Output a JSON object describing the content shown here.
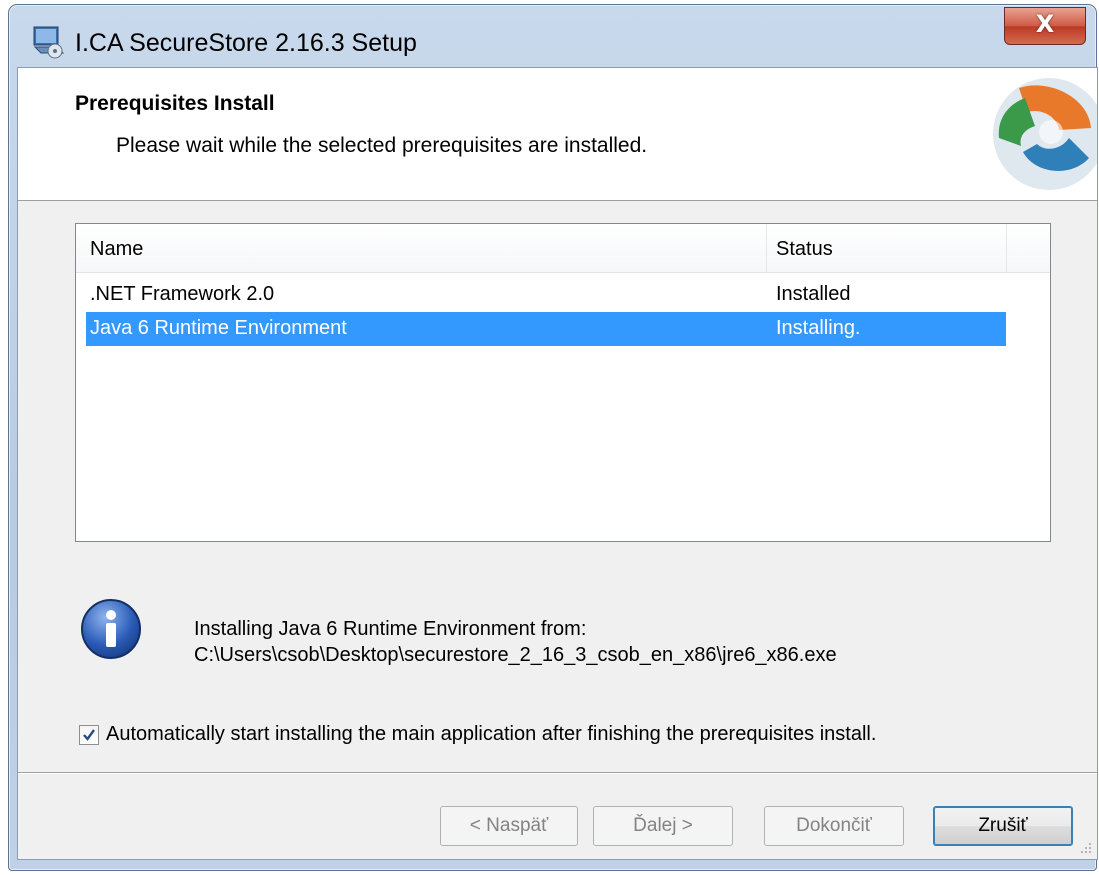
{
  "window": {
    "title": "I.CA SecureStore 2.16.3 Setup",
    "close_glyph": "X"
  },
  "banner": {
    "title": "Prerequisites Install",
    "subtitle": "Please wait while the selected prerequisites are installed."
  },
  "list": {
    "columns": {
      "name": "Name",
      "status": "Status"
    },
    "rows": [
      {
        "name": ".NET Framework 2.0",
        "status": "Installed",
        "selected": false
      },
      {
        "name": "Java 6 Runtime Environment",
        "status": "Installing.",
        "selected": true
      }
    ]
  },
  "info": {
    "line1": "Installing Java 6 Runtime Environment from:",
    "line2": "C:\\Users\\csob\\Desktop\\securestore_2_16_3_csob_en_x86\\jre6_x86.exe"
  },
  "auto_install": {
    "checked": true,
    "label": "Automatically start installing the main application after finishing the prerequisites install."
  },
  "buttons": {
    "back": "< Naspäť",
    "next": "Ďalej >",
    "finish": "Dokončiť",
    "cancel": "Zrušiť"
  },
  "colors": {
    "selection": "#3399ff",
    "info_icon": "#2a5bb8"
  }
}
